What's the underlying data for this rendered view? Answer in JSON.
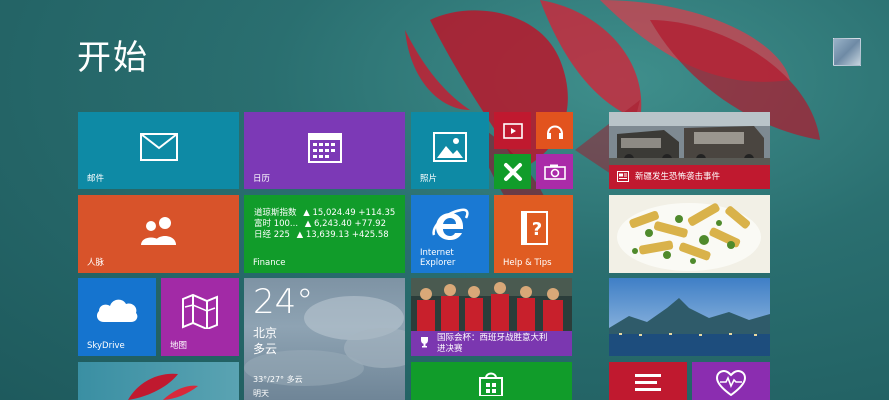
{
  "screen": {
    "title": "开始"
  },
  "tiles": {
    "mail": {
      "label": "邮件"
    },
    "calendar": {
      "label": "日历"
    },
    "photos": {
      "label": "照片"
    },
    "people": {
      "label": "人脉"
    },
    "finance": {
      "label": "Finance",
      "rows": [
        {
          "name": "道琼斯指数",
          "value": "▲ 15,024.49 +114.35"
        },
        {
          "name": "富时 100...",
          "value": "▲ 6,243.40 +77.92"
        },
        {
          "name": "日经 225",
          "value": "▲ 13,639.13 +425.58"
        }
      ]
    },
    "ie": {
      "label_line1": "Internet",
      "label_line2": "Explorer"
    },
    "help": {
      "label": "Help & Tips"
    },
    "skydrive": {
      "label": "SkyDrive"
    },
    "maps": {
      "label": "地图"
    },
    "weather": {
      "temp": "24°",
      "city": "北京",
      "condition": "多云",
      "range": "33°/27° 多云",
      "day": "明天"
    },
    "news": {
      "caption": "新疆发生恐怖袭击事件"
    },
    "sports": {
      "caption_line1": "国际会杯：西班牙战胜意大利",
      "caption_line2": "进决赛"
    }
  },
  "colors": {
    "teal": "#0e8aa5",
    "purple": "#7c39b6",
    "orange": "#d8532a",
    "green": "#119c2a",
    "blue": "#0d70c7",
    "magenta": "#aa2ba8",
    "red": "#d04126",
    "crimson": "#c0192f"
  }
}
